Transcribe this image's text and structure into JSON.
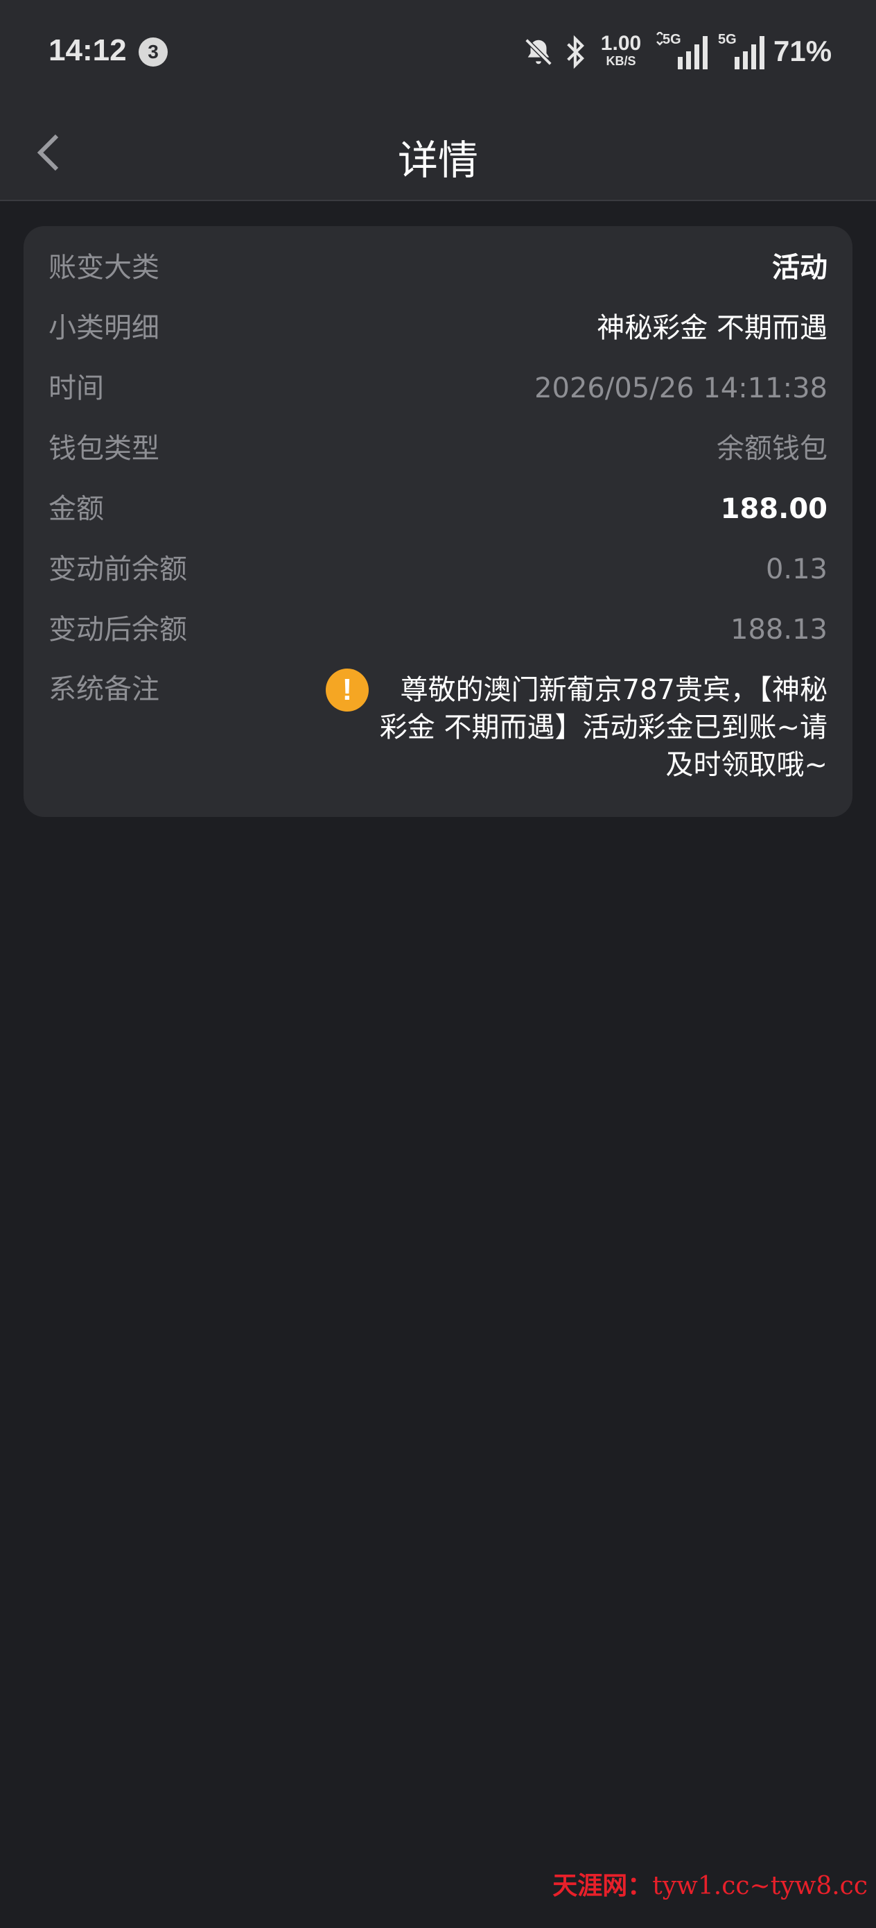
{
  "status_bar": {
    "time": "14:12",
    "notification_count": "3",
    "net_speed": "1.00",
    "net_speed_unit": "KB/S",
    "sim1_label": "5G",
    "sim2_label": "5G",
    "battery": "71%",
    "icons": [
      "bell-muted-icon",
      "bluetooth-icon",
      "signal-icon",
      "signal-icon"
    ]
  },
  "nav": {
    "title": "详情",
    "back_icon": "chevron-left-icon"
  },
  "details": {
    "rows": [
      {
        "label": "账变大类",
        "value": "活动"
      },
      {
        "label": "小类明细",
        "value": "神秘彩金 不期而遇"
      },
      {
        "label": "时间",
        "value": "2026/05/26 14:11:38"
      },
      {
        "label": "钱包类型",
        "value": "余额钱包"
      },
      {
        "label": "金额",
        "value": "188.00"
      },
      {
        "label": "变动前余额",
        "value": "0.13"
      },
      {
        "label": "变动后余额",
        "value": "188.13"
      }
    ],
    "remark": {
      "label": "系统备注",
      "icon": "exclamation-icon",
      "icon_glyph": "!",
      "text": "尊敬的澳门新葡京787贵宾，【神秘彩金 不期而遇】活动彩金已到账~请及时领取哦~"
    }
  },
  "watermark": {
    "site": "天涯网：",
    "url": "tyw1.cc~tyw8.cc"
  },
  "colors": {
    "background": "#1d1e22",
    "card": "#2c2d31",
    "muted_text": "#8e8f94",
    "warning": "#f5a623",
    "watermark": "#e8202a"
  }
}
